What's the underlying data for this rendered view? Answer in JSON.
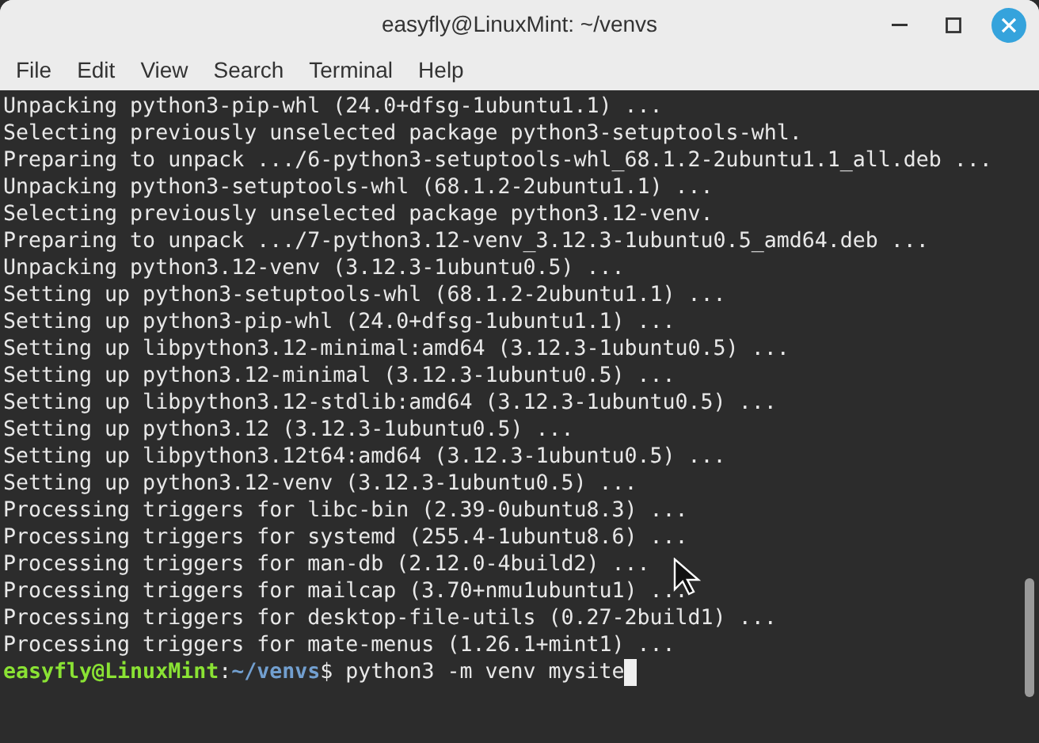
{
  "window": {
    "title": "easyfly@LinuxMint: ~/venvs"
  },
  "menu": [
    "File",
    "Edit",
    "View",
    "Search",
    "Terminal",
    "Help"
  ],
  "terminal": {
    "lines": [
      "Unpacking python3-pip-whl (24.0+dfsg-1ubuntu1.1) ...",
      "Selecting previously unselected package python3-setuptools-whl.",
      "Preparing to unpack .../6-python3-setuptools-whl_68.1.2-2ubuntu1.1_all.deb ...",
      "Unpacking python3-setuptools-whl (68.1.2-2ubuntu1.1) ...",
      "Selecting previously unselected package python3.12-venv.",
      "Preparing to unpack .../7-python3.12-venv_3.12.3-1ubuntu0.5_amd64.deb ...",
      "Unpacking python3.12-venv (3.12.3-1ubuntu0.5) ...",
      "Setting up python3-setuptools-whl (68.1.2-2ubuntu1.1) ...",
      "Setting up python3-pip-whl (24.0+dfsg-1ubuntu1.1) ...",
      "Setting up libpython3.12-minimal:amd64 (3.12.3-1ubuntu0.5) ...",
      "Setting up python3.12-minimal (3.12.3-1ubuntu0.5) ...",
      "Setting up libpython3.12-stdlib:amd64 (3.12.3-1ubuntu0.5) ...",
      "Setting up python3.12 (3.12.3-1ubuntu0.5) ...",
      "Setting up libpython3.12t64:amd64 (3.12.3-1ubuntu0.5) ...",
      "Setting up python3.12-venv (3.12.3-1ubuntu0.5) ...",
      "Processing triggers for libc-bin (2.39-0ubuntu8.3) ...",
      "Processing triggers for systemd (255.4-1ubuntu8.6) ...",
      "Processing triggers for man-db (2.12.0-4build2) ...",
      "Processing triggers for mailcap (3.70+nmu1ubuntu1) ...",
      "Processing triggers for desktop-file-utils (0.27-2build1) ...",
      "Processing triggers for mate-menus (1.26.1+mint1) ..."
    ],
    "prompt": {
      "user_host": "easyfly@LinuxMint",
      "separator": ":",
      "path": "~/venvs",
      "symbol": "$",
      "command": "python3 -m venv mysite"
    }
  }
}
